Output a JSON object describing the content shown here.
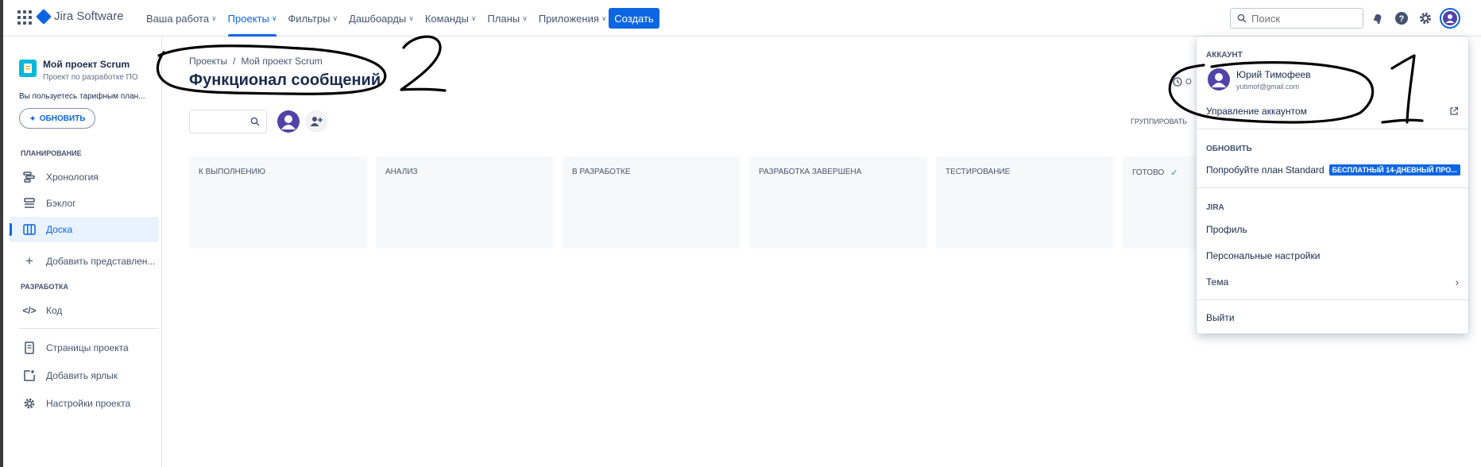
{
  "topnav": {
    "brand": "Jira Software",
    "items": [
      {
        "label": "Ваша работа",
        "active": false
      },
      {
        "label": "Проекты",
        "active": true
      },
      {
        "label": "Фильтры",
        "active": false
      },
      {
        "label": "Дашбоарды",
        "active": false
      },
      {
        "label": "Команды",
        "active": false
      },
      {
        "label": "Планы",
        "active": false
      },
      {
        "label": "Приложения",
        "active": false
      }
    ],
    "create_label": "Создать",
    "search_placeholder": "Поиск"
  },
  "sidebar": {
    "project_name": "Мой проект Scrum",
    "project_type": "Проект по разработке ПО",
    "plan_note": "Вы пользуетесь тарифным план...",
    "upgrade_label": "ОБНОВИТЬ",
    "planning_heading": "ПЛАНИРОВАНИЕ",
    "items": [
      {
        "label": "Хронология"
      },
      {
        "label": "Бэклог"
      },
      {
        "label": "Доска"
      },
      {
        "label": "Добавить представлен..."
      }
    ],
    "dev_heading": "РАЗРАБОТКА",
    "code_label": "Код",
    "bottom_items": [
      {
        "label": "Страницы проекта"
      },
      {
        "label": "Добавить ярлык"
      },
      {
        "label": "Настройки проекта"
      }
    ]
  },
  "main": {
    "breadcrumb": [
      "Проекты",
      "Мой проект Scrum"
    ],
    "title": "Функционал сообщений",
    "group_by": "ГРУППИРОВАТЬ",
    "clock_fragment": "О",
    "columns": [
      {
        "title": "К ВЫПОЛНЕНИЮ"
      },
      {
        "title": "АНАЛИЗ"
      },
      {
        "title": "В РАЗРАБОТКЕ"
      },
      {
        "title": "РАЗРАБОТКА ЗАВЕРШЕНА"
      },
      {
        "title": "ТЕСТИРОВАНИЕ"
      },
      {
        "title": "ГОТОВО"
      }
    ]
  },
  "account_menu": {
    "account_heading": "АККАУНТ",
    "user_name": "Юрий Тимофеев",
    "user_email": "yutimof@gmail.com",
    "manage_account": "Управление аккаунтом",
    "upgrade_heading": "ОБНОВИТЬ",
    "try_plan": "Попробуйте план Standard",
    "trial_badge": "БЕСПЛАТНЫЙ 14-ДНЕВНЫЙ ПРО...",
    "jira_heading": "JIRA",
    "profile": "Профиль",
    "personal_settings": "Персональные настройки",
    "theme": "Тема",
    "logout": "Выйти"
  },
  "annotations": {
    "numbers": [
      "1",
      "2"
    ]
  },
  "colors": {
    "accent": "#0c66e4",
    "avatar": "#5243aa",
    "column_bg": "#f7f8f9",
    "selected_bg": "#e9f2ff"
  }
}
